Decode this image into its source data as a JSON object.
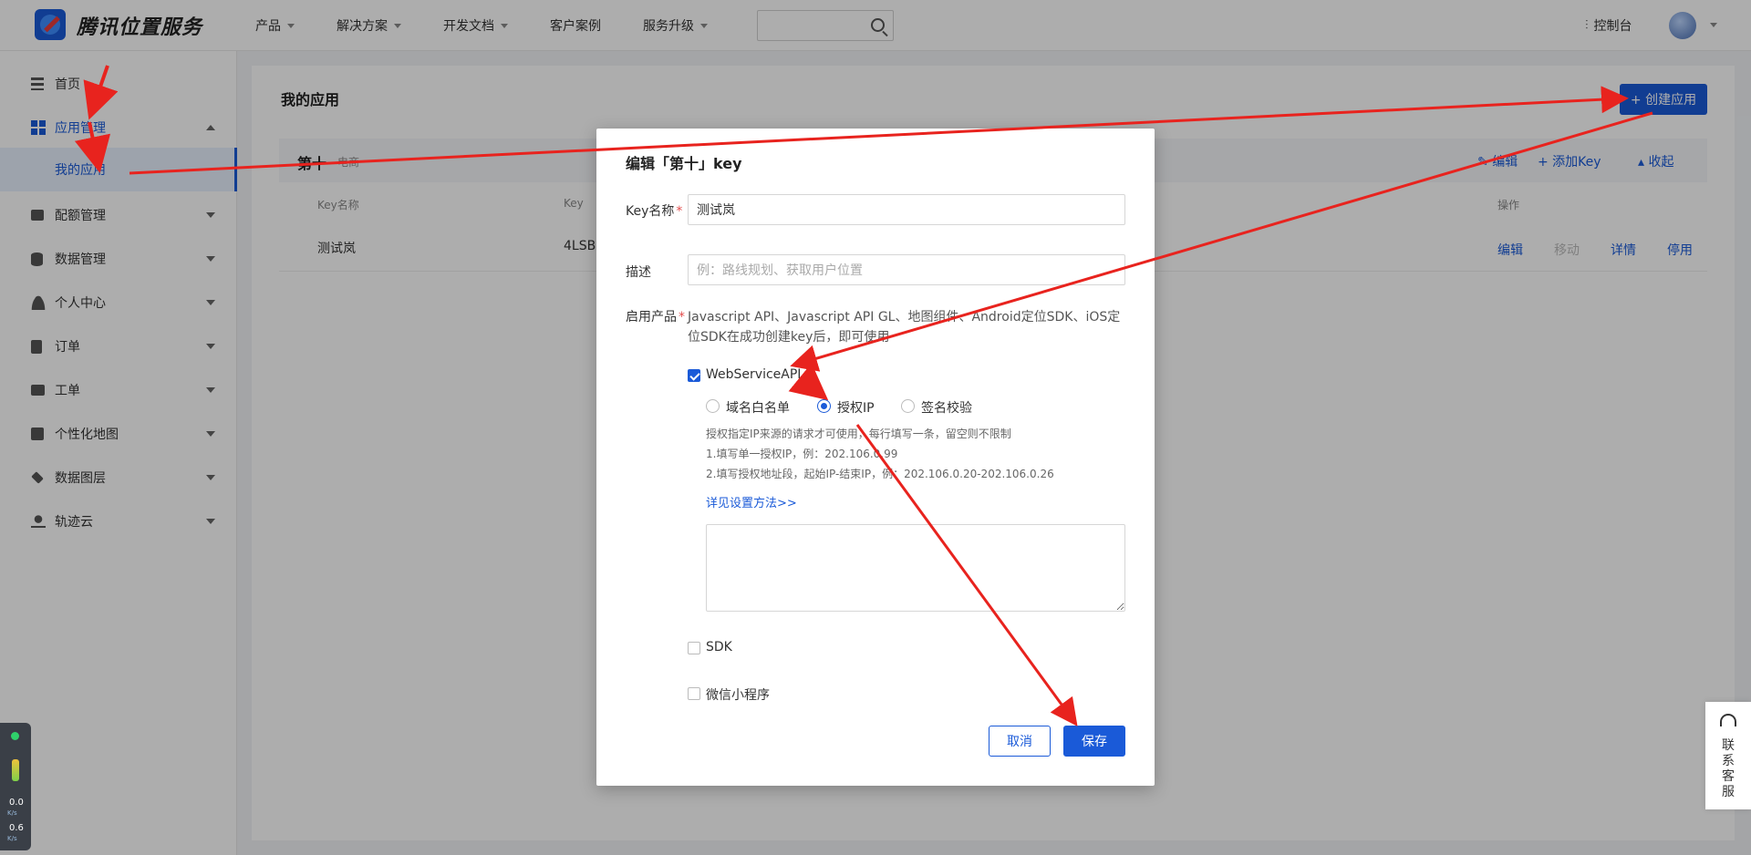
{
  "header": {
    "logo_text": "腾讯位置服务",
    "nav": [
      {
        "label": "产品",
        "has_caret": true
      },
      {
        "label": "解决方案",
        "has_caret": true
      },
      {
        "label": "开发文档",
        "has_caret": true
      },
      {
        "label": "客户案例",
        "has_caret": false
      },
      {
        "label": "服务升级",
        "has_caret": true
      }
    ],
    "search_placeholder": "",
    "console_label": "控制台"
  },
  "sidebar": {
    "items": [
      {
        "label": "首页",
        "icon": "list-icon"
      },
      {
        "label": "应用管理",
        "icon": "grid-icon",
        "expanded": true
      },
      {
        "label": "我的应用",
        "sub": true
      },
      {
        "label": "配额管理",
        "icon": "chart-icon"
      },
      {
        "label": "数据管理",
        "icon": "database-icon"
      },
      {
        "label": "个人中心",
        "icon": "user-icon"
      },
      {
        "label": "订单",
        "icon": "clipboard-icon"
      },
      {
        "label": "工单",
        "icon": "ticket-icon"
      },
      {
        "label": "个性化地图",
        "icon": "map-icon"
      },
      {
        "label": "数据图层",
        "icon": "layers-icon"
      },
      {
        "label": "轨迹云",
        "icon": "track-icon"
      }
    ]
  },
  "main": {
    "title": "我的应用",
    "create_button": "+ 创建应用",
    "app": {
      "name": "第十",
      "tag": "电商",
      "actions": {
        "edit": "编辑",
        "add_key": "+ 添加Key",
        "collapse": "收起"
      }
    },
    "table": {
      "headers": {
        "key_name": "Key名称",
        "key": "Key",
        "ops": "操作"
      },
      "rows": [
        {
          "key_name": "测试岚",
          "key": "4LSB",
          "ops": [
            "编辑",
            "移动",
            "详情",
            "停用"
          ]
        }
      ]
    }
  },
  "modal": {
    "title": "编辑「第十」key",
    "key_name_label": "Key名称",
    "key_name_value": "测试岚",
    "desc_label": "描述",
    "desc_placeholder": "例：路线规划、获取用户位置",
    "products_label": "启用产品",
    "products_desc": "Javascript API、Javascript API GL、地图组件、Android定位SDK、iOS定位SDK在成功创建key后，即可使用",
    "webservice_label": "WebServiceAPI",
    "webservice_checked": true,
    "radios": [
      {
        "label": "域名白名单",
        "selected": false
      },
      {
        "label": "授权IP",
        "selected": true
      },
      {
        "label": "签名校验",
        "selected": false
      }
    ],
    "hints": [
      "授权指定IP来源的请求才可使用，每行填写一条，留空则不限制",
      "1.填写单一授权IP，例：202.106.0.99",
      "2.填写授权地址段，起始IP-结束IP，例：202.106.0.20-202.106.0.26"
    ],
    "detail_link": "详见设置方法>>",
    "ip_textarea_value": "",
    "sdk_label": "SDK",
    "miniprogram_label": "微信小程序",
    "cancel_label": "取消",
    "save_label": "保存"
  },
  "float": {
    "service_text": "联系客服",
    "net_up": "0.0",
    "net_down": "0.6",
    "unit": "K/s"
  },
  "colors": {
    "accent": "#1a5ad8",
    "arrow": "#e8231e",
    "required": "#e34d4d"
  }
}
